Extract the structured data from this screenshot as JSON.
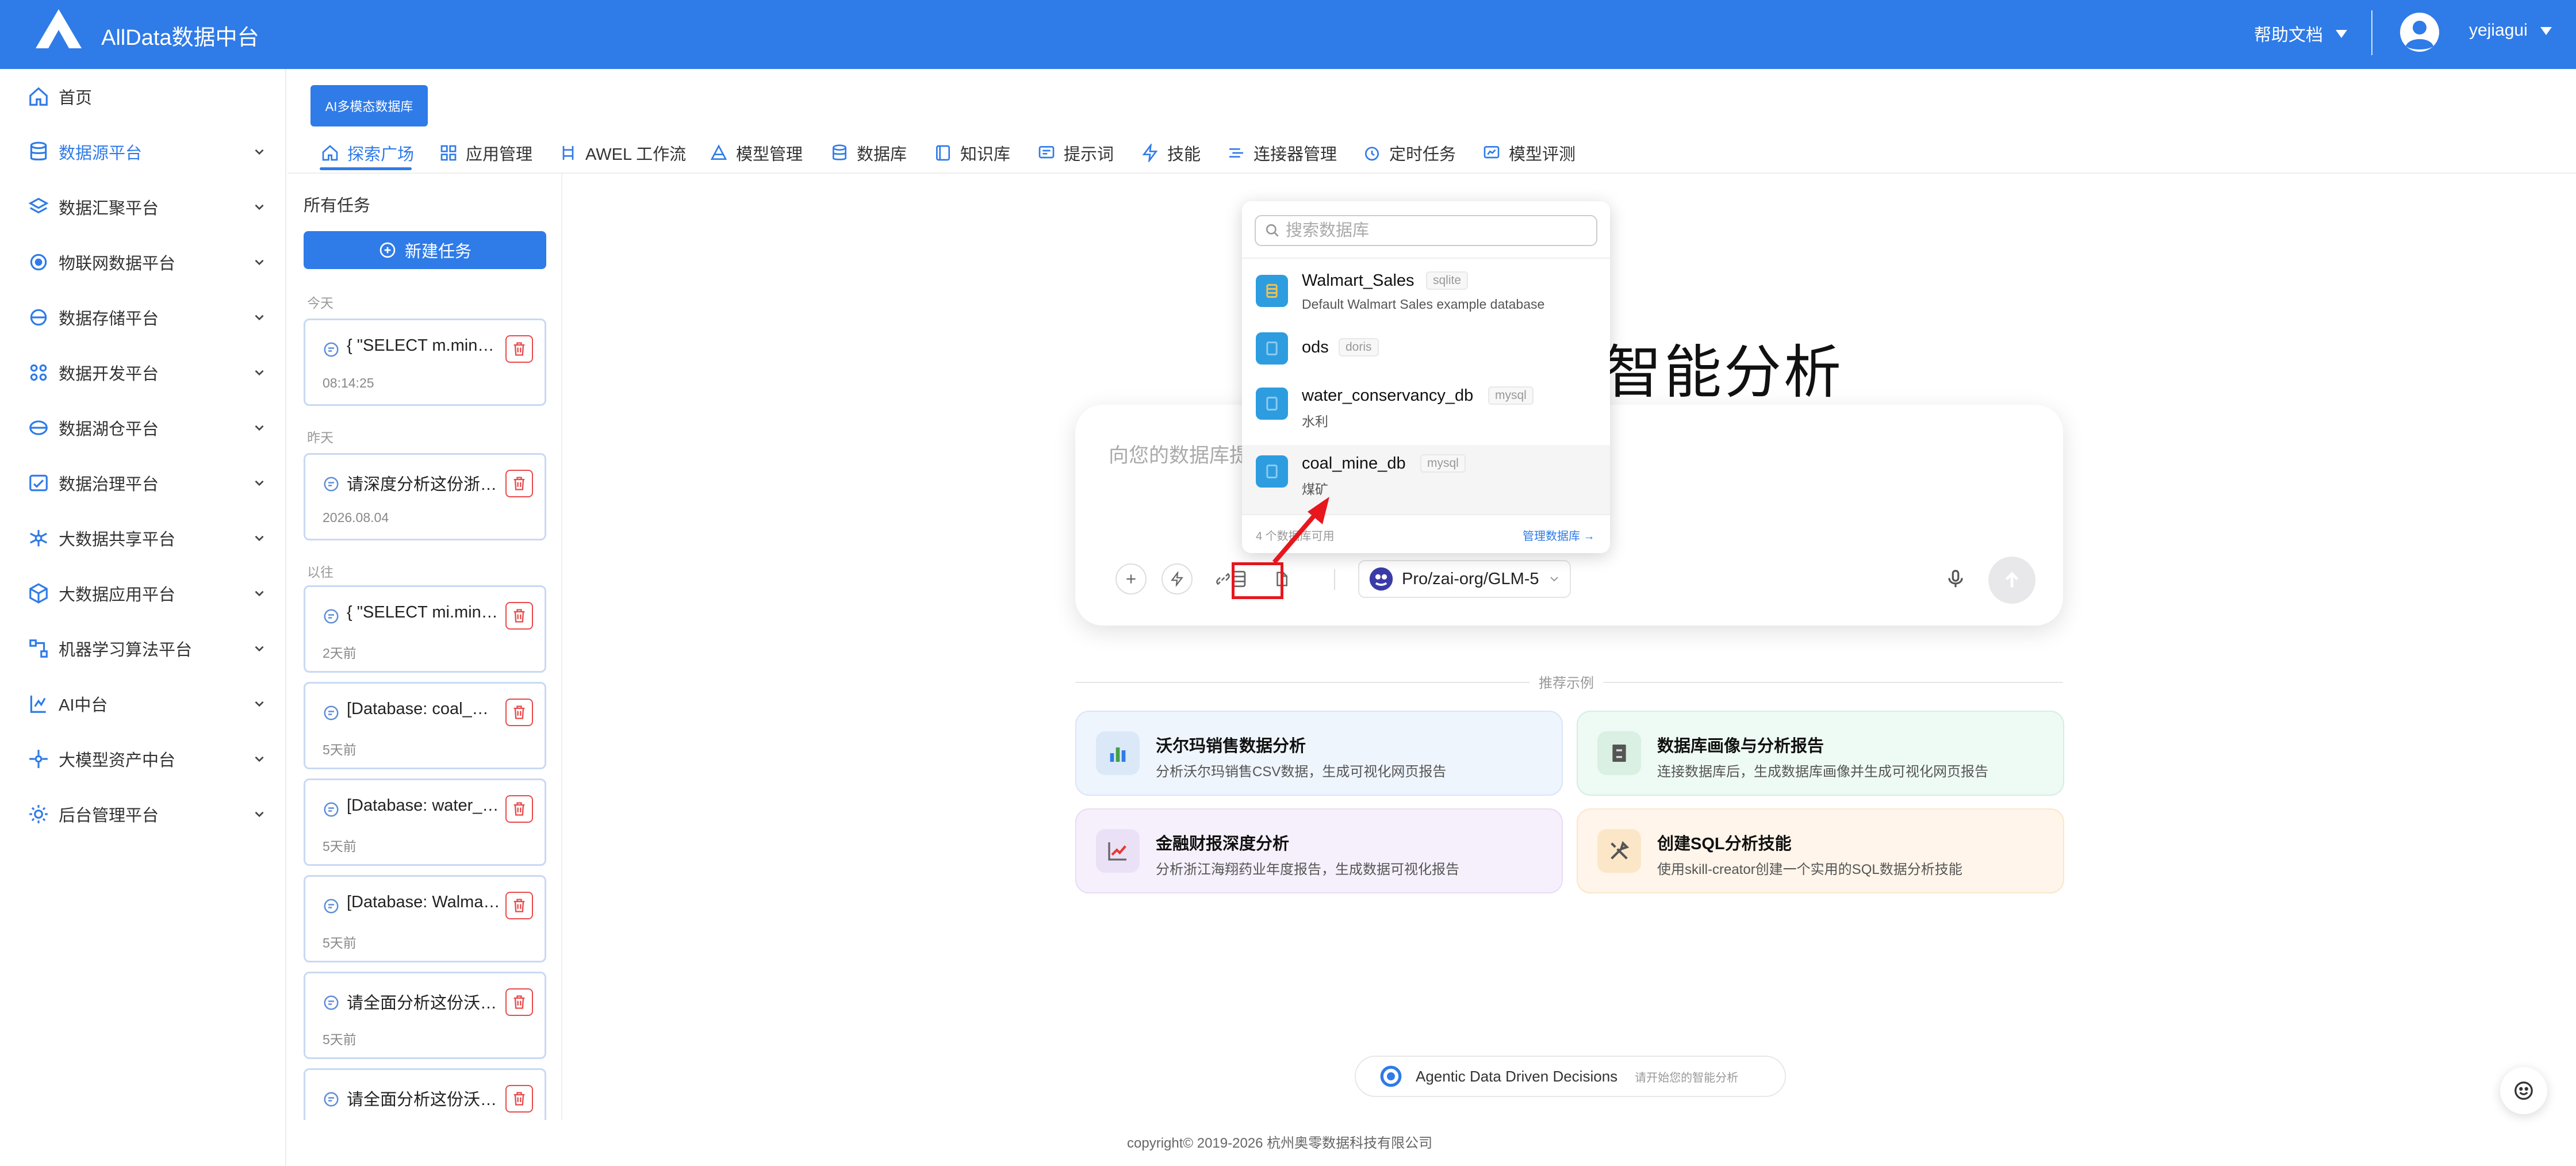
{
  "header": {
    "app_title": "AllData数据中台",
    "help_label": "帮助文档",
    "username": "yejiagui"
  },
  "nav": {
    "items": [
      {
        "label": "首页",
        "icon": "home-icon"
      },
      {
        "label": "数据源平台",
        "icon": "database-icon"
      },
      {
        "label": "数据汇聚平台",
        "icon": "layers-icon"
      },
      {
        "label": "物联网数据平台",
        "icon": "iot-icon"
      },
      {
        "label": "数据存储平台",
        "icon": "storage-icon"
      },
      {
        "label": "数据开发平台",
        "icon": "grid-icon"
      },
      {
        "label": "数据湖仓平台",
        "icon": "lakehouse-icon"
      },
      {
        "label": "数据治理平台",
        "icon": "governance-icon"
      },
      {
        "label": "大数据共享平台",
        "icon": "share-icon"
      },
      {
        "label": "大数据应用平台",
        "icon": "cube-icon"
      },
      {
        "label": "机器学习算法平台",
        "icon": "ml-icon"
      },
      {
        "label": "AI中台",
        "icon": "ai-icon"
      },
      {
        "label": "大模型资产中台",
        "icon": "model-asset-icon"
      },
      {
        "label": "后台管理平台",
        "icon": "admin-icon"
      }
    ]
  },
  "ai_badge": "AI多模态数据库",
  "tabs": [
    {
      "label": "探索广场",
      "icon": "home-icon"
    },
    {
      "label": "应用管理",
      "icon": "apps-icon"
    },
    {
      "label": "AWEL 工作流",
      "icon": "workflow-icon"
    },
    {
      "label": "模型管理",
      "icon": "model-icon"
    },
    {
      "label": "数据库",
      "icon": "database-icon"
    },
    {
      "label": "知识库",
      "icon": "book-icon"
    },
    {
      "label": "提示词",
      "icon": "prompt-icon"
    },
    {
      "label": "技能",
      "icon": "lightning-icon"
    },
    {
      "label": "连接器管理",
      "icon": "connector-icon"
    },
    {
      "label": "定时任务",
      "icon": "alarm-icon"
    },
    {
      "label": "模型评测",
      "icon": "evaluation-icon"
    }
  ],
  "tasks": {
    "title": "所有任务",
    "new_task_label": "新建任务",
    "sections": {
      "today": "今天",
      "yesterday": "昨天",
      "earlier": "以往"
    },
    "items": [
      {
        "text": "{ \"SELECT m.mine_name...",
        "date": "08:14:25"
      },
      {
        "text": "请深度分析这份浙江海翔药业...",
        "date": "2026.08.04"
      },
      {
        "text": "{ \"SELECT mi.mine_name...",
        "date": "2天前"
      },
      {
        "text": "[Database: coal_mine_db]...",
        "date": "5天前"
      },
      {
        "text": "[Database: water_conservancy...",
        "date": "5天前"
      },
      {
        "text": "[Database: Walmart_Sales]...",
        "date": "5天前"
      },
      {
        "text": "请全面分析这份沃尔玛销售数据...",
        "date": "5天前"
      },
      {
        "text": "请全面分析这份沃尔玛销售数据...",
        "date": ""
      }
    ]
  },
  "main": {
    "title": "智能分析",
    "chat_placeholder": "向您的数据库提问",
    "model": "Pro/zai-org/GLM-5"
  },
  "db_dropdown": {
    "search_placeholder": "搜索数据库",
    "items": [
      {
        "name": "Walmart_Sales",
        "type": "sqlite",
        "desc": "Default Walmart Sales example database"
      },
      {
        "name": "ods",
        "type": "doris",
        "desc": ""
      },
      {
        "name": "water_conservancy_db",
        "type": "mysql",
        "desc": "水利"
      },
      {
        "name": "coal_mine_db",
        "type": "mysql",
        "desc": "煤矿"
      }
    ],
    "count_text": "4 个数据库可用",
    "manage_link": "管理数据库 →"
  },
  "examples": {
    "label": "推荐示例",
    "items": [
      {
        "title": "沃尔玛销售数据分析",
        "desc": "分析沃尔玛销售CSV数据，生成可视化网页报告",
        "icon": "bar-chart-icon"
      },
      {
        "title": "数据库画像与分析报告",
        "desc": "连接数据库后，生成数据库画像并生成可视化网页报告",
        "icon": "cabinet-icon"
      },
      {
        "title": "金融财报深度分析",
        "desc": "分析浙江海翔药业年度报告，生成数据可视化报告",
        "icon": "trend-chart-icon"
      },
      {
        "title": "创建SQL分析技能",
        "desc": "使用skill-creator创建一个实用的SQL数据分析技能",
        "icon": "tools-icon"
      }
    ]
  },
  "footer": {
    "agentic": "Agentic Data Driven Decisions",
    "agentic_sub": "请开始您的智能分析",
    "copyright": "copyright© 2019-2026 杭州奥零数据科技有限公司"
  },
  "colors": {
    "accent": "#2f7be8",
    "highlight": "#e8161d",
    "danger": "#e94a4a"
  }
}
